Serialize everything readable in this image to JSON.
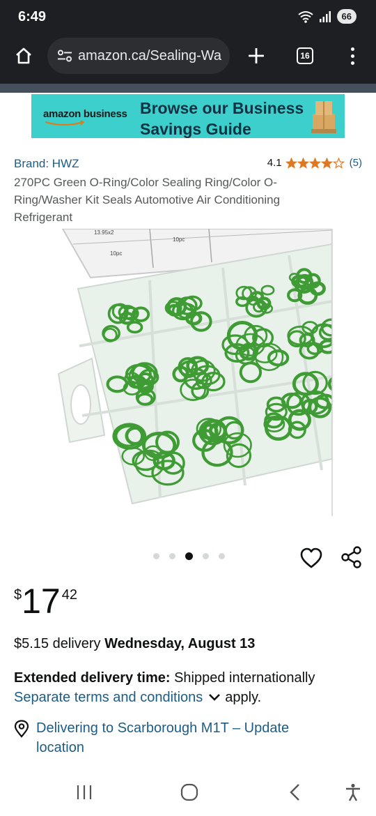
{
  "status_bar": {
    "time": "6:49",
    "battery": "66",
    "icons": [
      "wifi-icon",
      "signal-icon"
    ]
  },
  "browser": {
    "url": "amazon.ca/Sealing-Wa",
    "tab_count": "16",
    "icons": [
      "home-icon",
      "site-settings-icon",
      "new-tab-icon",
      "tabs-icon",
      "menu-icon"
    ]
  },
  "banner": {
    "logo_text": "amazon business",
    "headline": "Browse our Business Savings Guide"
  },
  "product": {
    "brand": "Brand: HWZ",
    "rating_value": "4.1",
    "rating_stars": 4.1,
    "rating_count": "(5)",
    "title": "270PC Green O-Ring/Color Sealing Ring/Color O-Ring/Washer Kit Seals Automotive Air Conditioning Refrigerant",
    "image_labels": [
      "13.95x2",
      "10pc",
      "10pc"
    ],
    "carousel": {
      "total": 5,
      "active_index": 2
    }
  },
  "price": {
    "symbol": "$",
    "whole": "17",
    "fraction": "42"
  },
  "delivery": {
    "prefix": "$5.15 delivery ",
    "date": "Wednesday, August 13"
  },
  "extended": {
    "label": "Extended delivery time:",
    "text": " Shipped internationally",
    "terms_link": "Separate terms and conditions",
    "terms_suffix": "apply."
  },
  "location": {
    "text": "Delivering to Scarborough M1T – Update location"
  },
  "colors": {
    "link": "#1c5c85",
    "star": "#de7921",
    "banner_bg": "#3ccfcb",
    "ring_green": "#3f9c35"
  }
}
